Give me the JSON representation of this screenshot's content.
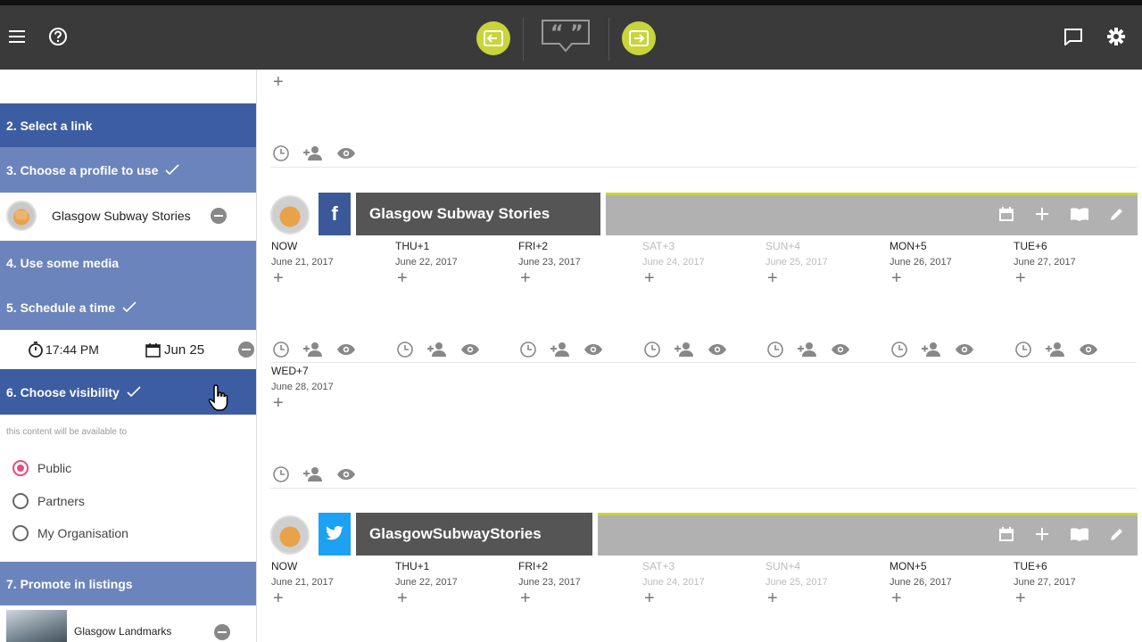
{
  "colors": {
    "topbar": "#3a3a3a",
    "accent_green": "#c8d53a",
    "step_dark": "#3d5da3",
    "step_light": "#6b84bc",
    "facebook": "#3b5998",
    "twitter": "#1da1f2",
    "radio_selected": "#e84a7f"
  },
  "topbar": {
    "icons": [
      "menu-icon",
      "help-icon",
      "login-icon",
      "quote-icon",
      "logout-icon",
      "chat-icon",
      "gear-icon"
    ]
  },
  "sidebar": {
    "steps": [
      {
        "label": "2. Select a link",
        "done": false
      },
      {
        "label": "3. Choose a profile to use",
        "done": true
      },
      {
        "label": "4. Use some media",
        "done": false
      },
      {
        "label": "5. Schedule a time",
        "done": true
      },
      {
        "label": "6. Choose visibility",
        "done": true
      },
      {
        "label": "7. Promote in listings",
        "done": false
      }
    ],
    "profile_name": "Glasgow Subway Stories",
    "schedule": {
      "time": "17:44 PM",
      "date": "Jun 25"
    },
    "visibility_note": "this content will be available to",
    "visibility_options": [
      {
        "label": "Public",
        "selected": true
      },
      {
        "label": "Partners",
        "selected": false
      },
      {
        "label": "My Organisation",
        "selected": false
      }
    ],
    "listing_name": "Glasgow Landmarks"
  },
  "main": {
    "profiles": [
      {
        "network": "facebook",
        "name": "Glasgow Subway Stories",
        "days": [
          {
            "name": "NOW",
            "date": "June 21, 2017",
            "dim": false
          },
          {
            "name": "THU+1",
            "date": "June 22, 2017",
            "dim": false
          },
          {
            "name": "FRI+2",
            "date": "June 23, 2017",
            "dim": false
          },
          {
            "name": "SAT+3",
            "date": "June 24, 2017",
            "dim": true
          },
          {
            "name": "SUN+4",
            "date": "June 25, 2017",
            "dim": true
          },
          {
            "name": "MON+5",
            "date": "June 26, 2017",
            "dim": false
          },
          {
            "name": "TUE+6",
            "date": "June 27, 2017",
            "dim": false
          }
        ],
        "extra_day": {
          "name": "WED+7",
          "date": "June 28, 2017"
        }
      },
      {
        "network": "twitter",
        "name": "GlasgowSubwayStories",
        "days": [
          {
            "name": "NOW",
            "date": "June 21, 2017",
            "dim": false
          },
          {
            "name": "THU+1",
            "date": "June 22, 2017",
            "dim": false
          },
          {
            "name": "FRI+2",
            "date": "June 23, 2017",
            "dim": false
          },
          {
            "name": "SAT+3",
            "date": "June 24, 2017",
            "dim": true
          },
          {
            "name": "SUN+4",
            "date": "June 25, 2017",
            "dim": true
          },
          {
            "name": "MON+5",
            "date": "June 26, 2017",
            "dim": false
          },
          {
            "name": "TUE+6",
            "date": "June 27, 2017",
            "dim": false
          }
        ]
      }
    ]
  }
}
